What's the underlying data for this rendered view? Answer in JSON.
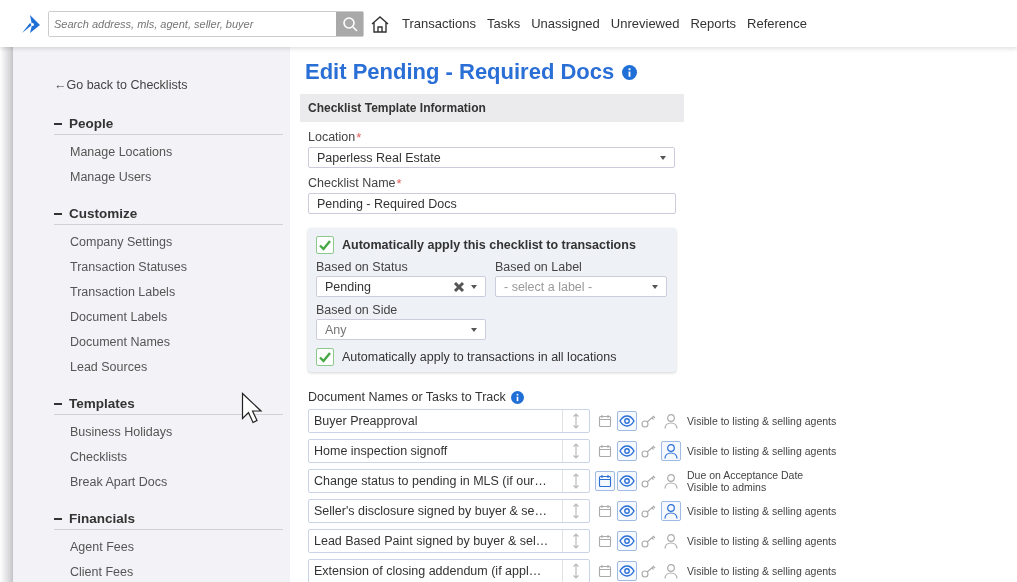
{
  "top_bar": {
    "search": {
      "placeholder": "Search address, mls, agent, seller, buyer"
    },
    "nav": [
      "Transactions",
      "Tasks",
      "Unassigned",
      "Unreviewed",
      "Reports",
      "Reference"
    ]
  },
  "sidebar": {
    "back_link": "←Go back to Checklists",
    "sections": [
      {
        "title": "People",
        "expanded": true,
        "items": [
          "Manage Locations",
          "Manage Users"
        ]
      },
      {
        "title": "Customize",
        "expanded": true,
        "items": [
          "Company Settings",
          "Transaction Statuses",
          "Transaction Labels",
          "Document Labels",
          "Document Names",
          "Lead Sources"
        ]
      },
      {
        "title": "Templates",
        "expanded": true,
        "items": [
          "Business Holidays",
          "Checklists",
          "Break Apart Docs"
        ]
      },
      {
        "title": "Financials",
        "expanded": true,
        "items": [
          "Agent Fees",
          "Client Fees"
        ]
      }
    ]
  },
  "page": {
    "title": "Edit Pending - Required Docs",
    "section_title": "Checklist Template Information",
    "location": {
      "label": "Location",
      "required_mark": "*",
      "value": "Paperless Real Estate"
    },
    "checklist_name": {
      "label": "Checklist Name",
      "required_mark": "*",
      "value": "Pending - Required Docs"
    },
    "auto_apply": {
      "label": "Automatically apply this checklist to transactions",
      "checked": true,
      "status": {
        "label": "Based on Status",
        "value": "Pending"
      },
      "label_filter": {
        "label": "Based on Label",
        "placeholder": "- select a label -"
      },
      "side": {
        "label": "Based on Side",
        "value": "Any"
      },
      "all_locations": {
        "label": "Automatically apply to transactions in all locations",
        "checked": true
      }
    },
    "documents": {
      "label": "Document Names or Tasks to Track",
      "items": [
        {
          "name": "Buyer Preapproval",
          "due_date": false,
          "visible": true,
          "assigned": false,
          "notes": [
            "Visible to listing & selling agents"
          ]
        },
        {
          "name": "Home inspection signoff",
          "due_date": false,
          "visible": true,
          "assigned": true,
          "notes": [
            "Visible to listing & selling agents"
          ]
        },
        {
          "name": "Change status to pending in MLS (if our…",
          "due_date": true,
          "visible": true,
          "assigned": false,
          "notes": [
            "Due on Acceptance Date",
            "Visible to admins"
          ]
        },
        {
          "name": "Seller's disclosure signed by buyer & se…",
          "due_date": false,
          "visible": true,
          "assigned": true,
          "notes": [
            "Visible to listing & selling agents"
          ]
        },
        {
          "name": "Lead Based Paint signed by buyer & sel…",
          "due_date": false,
          "visible": true,
          "assigned": false,
          "notes": [
            "Visible to listing & selling agents"
          ]
        },
        {
          "name": "Extension of closing addendum (if appl…",
          "due_date": false,
          "visible": true,
          "assigned": false,
          "notes": [
            "Visible to listing & selling agents"
          ]
        }
      ]
    }
  }
}
